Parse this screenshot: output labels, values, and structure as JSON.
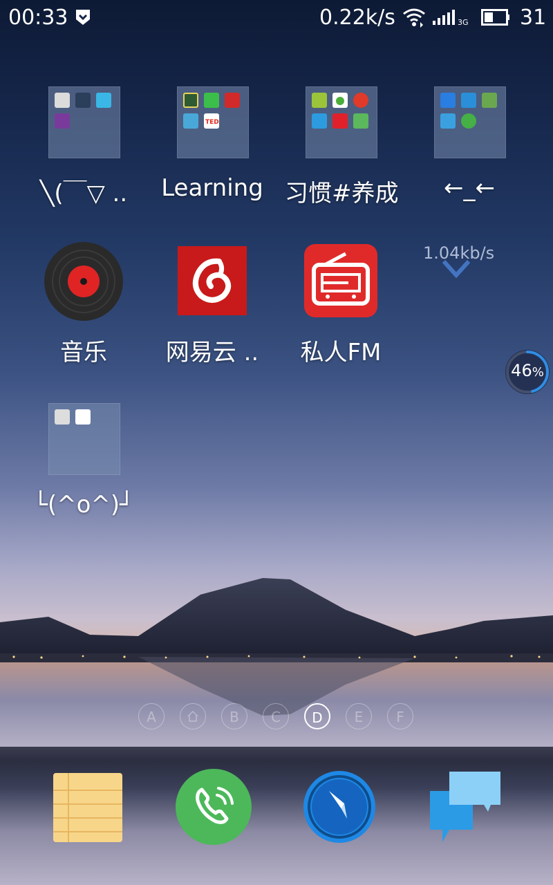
{
  "status_bar": {
    "time": "00:33",
    "net_speed": "0.22k/s",
    "battery_level": "31",
    "icons": [
      "shield-icon",
      "wifi-icon",
      "signal-3g-icon",
      "battery-icon"
    ]
  },
  "folders_row1": [
    {
      "label": "╲(￣▽ ..",
      "apps": [
        "app-black",
        "kindle",
        "one",
        "onenote"
      ]
    },
    {
      "label": "Learning",
      "apps": [
        "coursera",
        "green-app",
        "red-app",
        "blue-app",
        "ted"
      ]
    },
    {
      "label": "习惯#养成",
      "apps": [
        "green-field",
        "drop-app",
        "todoist",
        "check-app",
        "calendar-app",
        "evernote"
      ]
    },
    {
      "label": "←_←",
      "apps": [
        "shield-app",
        "anchor-app",
        "globe-app",
        "es-file",
        "key-app"
      ]
    }
  ],
  "apps_row2": [
    {
      "label": "音乐",
      "icon": "vinyl-record-icon"
    },
    {
      "label": "网易云 ..",
      "icon": "netease-cloud-music-icon"
    },
    {
      "label": "私人FM",
      "icon": "radio-icon"
    }
  ],
  "widget_speed": "1.04kb/s",
  "memory_percent": "46",
  "folder_row3": {
    "label": "└(^o^)┘",
    "apps": [
      "cartoon-app",
      "youku"
    ]
  },
  "page_indicators": [
    "A",
    "home",
    "B",
    "C",
    "D",
    "E",
    "F"
  ],
  "active_page": "D",
  "dock": [
    "notes-icon",
    "phone-icon",
    "browser-compass-icon",
    "messages-icon"
  ],
  "colors": {
    "accent_red": "#e02424",
    "netease_red": "#c81a1a",
    "phone_green": "#4cb85a",
    "browser_blue": "#1e88e5"
  }
}
